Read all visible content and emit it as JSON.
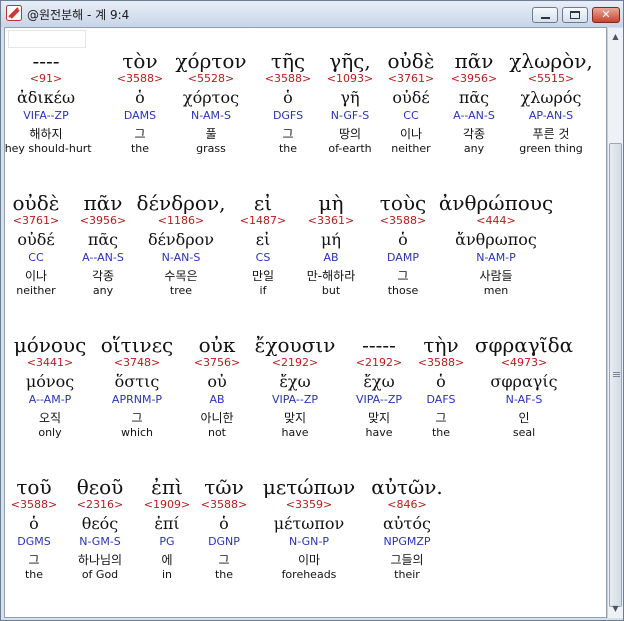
{
  "window": {
    "title": "@원전분해 - 계 9:4"
  },
  "rows": [
    {
      "words": [
        {
          "greek": "----",
          "strong": "<91>",
          "lemma": "ἀδικέω",
          "parse": "VIFA--ZP",
          "korean": "해하지",
          "english": "they should-hurt"
        },
        {
          "greek": "τὸν",
          "strong": "<3588>",
          "lemma": "ὁ",
          "parse": "DAMS",
          "korean": "그",
          "english": "the"
        },
        {
          "greek": "χόρτον",
          "strong": "<5528>",
          "lemma": "χόρτος",
          "parse": "N-AM-S",
          "korean": "풀",
          "english": "grass"
        },
        {
          "greek": "τῆς",
          "strong": "<3588>",
          "lemma": "ὁ",
          "parse": "DGFS",
          "korean": "그",
          "english": "the"
        },
        {
          "greek": "γῆς,",
          "strong": "<1093>",
          "lemma": "γῆ",
          "parse": "N-GF-S",
          "korean": "땅의",
          "english": "of-earth"
        },
        {
          "greek": "οὐδὲ",
          "strong": "<3761>",
          "lemma": "οὐδέ",
          "parse": "CC",
          "korean": "이나",
          "english": "neither"
        },
        {
          "greek": "πᾶν",
          "strong": "<3956>",
          "lemma": "πᾶς",
          "parse": "A--AN-S",
          "korean": "각종",
          "english": "any"
        },
        {
          "greek": "χλωρὸν,",
          "strong": "<5515>",
          "lemma": "χλωρός",
          "parse": "AP-AN-S",
          "korean": "푸른 것",
          "english": "green thing"
        }
      ]
    },
    {
      "words": [
        {
          "greek": "οὐδὲ",
          "strong": "<3761>",
          "lemma": "οὐδέ",
          "parse": "CC",
          "korean": "이나",
          "english": "neither"
        },
        {
          "greek": "πᾶν",
          "strong": "<3956>",
          "lemma": "πᾶς",
          "parse": "A--AN-S",
          "korean": "각종",
          "english": "any"
        },
        {
          "greek": "δένδρον,",
          "strong": "<1186>",
          "lemma": "δένδρον",
          "parse": "N-AN-S",
          "korean": "수목은",
          "english": "tree"
        },
        {
          "greek": "εἰ",
          "strong": "<1487>",
          "lemma": "εἰ",
          "parse": "CS",
          "korean": "만일",
          "english": "if"
        },
        {
          "greek": "μὴ",
          "strong": "<3361>",
          "lemma": "μή",
          "parse": "AB",
          "korean": "만-해하라",
          "english": "but"
        },
        {
          "greek": "τοὺς",
          "strong": "<3588>",
          "lemma": "ὁ",
          "parse": "DAMP",
          "korean": "그",
          "english": "those"
        },
        {
          "greek": "ἀνθρώπους",
          "strong": "<444>",
          "lemma": "ἄνθρωπος",
          "parse": "N-AM-P",
          "korean": "사람들",
          "english": "men"
        }
      ]
    },
    {
      "words": [
        {
          "greek": "μόνους",
          "strong": "<3441>",
          "lemma": "μόνος",
          "parse": "A--AM-P",
          "korean": "오직",
          "english": "only"
        },
        {
          "greek": "οἵτινες",
          "strong": "<3748>",
          "lemma": "ὅστις",
          "parse": "APRNM-P",
          "korean": "그",
          "english": "which"
        },
        {
          "greek": "οὐκ",
          "strong": "<3756>",
          "lemma": "οὐ",
          "parse": "AB",
          "korean": "아니한",
          "english": "not"
        },
        {
          "greek": "ἔχουσιν",
          "strong": "<2192>",
          "lemma": "ἔχω",
          "parse": "VIPA--ZP",
          "korean": "맞지",
          "english": "have"
        },
        {
          "greek": "-----",
          "strong": "<2192>",
          "lemma": "ἔχω",
          "parse": "VIPA--ZP",
          "korean": "맞지",
          "english": "have"
        },
        {
          "greek": "τὴν",
          "strong": "<3588>",
          "lemma": "ὁ",
          "parse": "DAFS",
          "korean": "그",
          "english": "the"
        },
        {
          "greek": "σφραγῖδα",
          "strong": "<4973>",
          "lemma": "σφραγίς",
          "parse": "N-AF-S",
          "korean": "인",
          "english": "seal"
        }
      ]
    },
    {
      "words": [
        {
          "greek": "τοῦ",
          "strong": "<3588>",
          "lemma": "ὁ",
          "parse": "DGMS",
          "korean": "그",
          "english": "the"
        },
        {
          "greek": "θεοῦ",
          "strong": "<2316>",
          "lemma": "θεός",
          "parse": "N-GM-S",
          "korean": "하나님의",
          "english": "of God"
        },
        {
          "greek": "ἐπὶ",
          "strong": "<1909>",
          "lemma": "ἐπί",
          "parse": "PG",
          "korean": "에",
          "english": "in"
        },
        {
          "greek": "τῶν",
          "strong": "<3588>",
          "lemma": "ὁ",
          "parse": "DGNP",
          "korean": "그",
          "english": "the"
        },
        {
          "greek": "μετώπων",
          "strong": "<3359>",
          "lemma": "μέτωπον",
          "parse": "N-GN-P",
          "korean": "이마",
          "english": "foreheads"
        },
        {
          "greek": "αὐτῶν.",
          "strong": "<846>",
          "lemma": "αὐτός",
          "parse": "NPGMZP",
          "korean": "그들의",
          "english": "their"
        }
      ]
    }
  ]
}
